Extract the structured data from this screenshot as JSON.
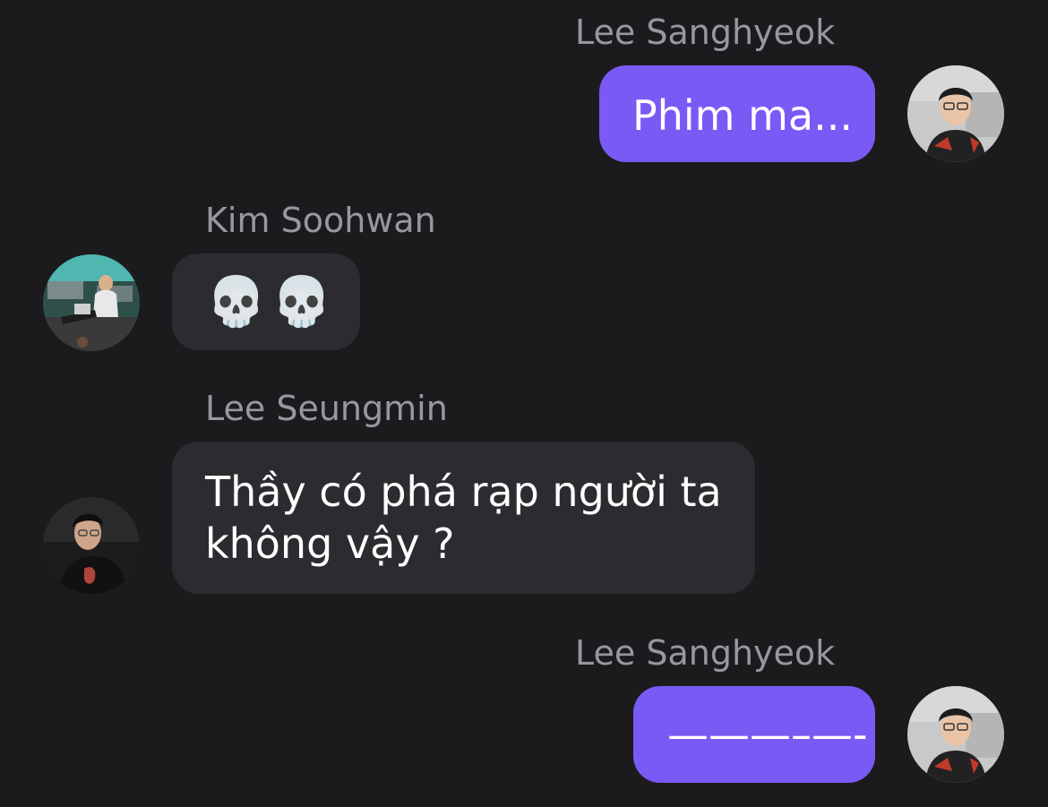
{
  "messages": [
    {
      "sender": "Lee Sanghyeok",
      "text": "Phim ma...",
      "direction": "outgoing",
      "avatar": "avatar-photo-lee-sanghyeok"
    },
    {
      "sender": "Kim Soohwan",
      "text": "💀💀",
      "direction": "incoming",
      "avatar": "avatar-photo-kim-soohwan"
    },
    {
      "sender": "Lee Seungmin",
      "lines": [
        "Thầy có phá rạp người ta",
        "không vậy ?"
      ],
      "direction": "incoming",
      "avatar": "avatar-photo-lee-seungmin"
    },
    {
      "sender": "Lee Sanghyeok",
      "text": "———–—-",
      "direction": "outgoing",
      "avatar": "avatar-photo-lee-sanghyeok"
    }
  ],
  "colors": {
    "background": "#1b1b1e",
    "outgoing_bubble": "#7a5af5",
    "incoming_bubble": "#2c2c30",
    "sender_name": "#98979f",
    "message_text": "#ffffff"
  }
}
